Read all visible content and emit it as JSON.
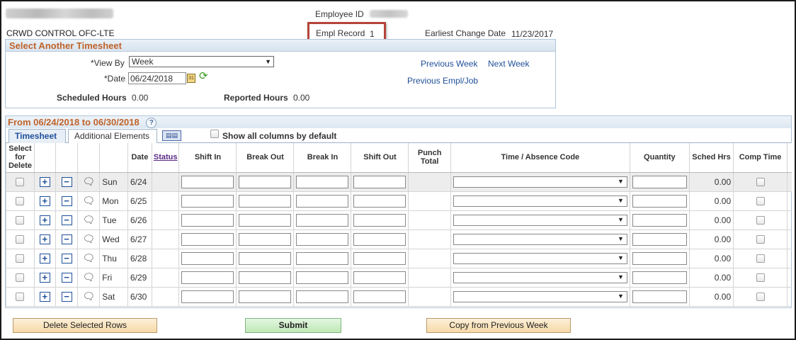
{
  "header": {
    "employee_name": "ALEXTRA GURBSLCHEDX",
    "department": "CRWD CONTROL OFC-LTE",
    "employee_id_label": "Employee ID",
    "employee_id_value": "00712658",
    "empl_record_label": "Empl Record",
    "empl_record_value": "1",
    "earliest_change_label": "Earliest Change Date",
    "earliest_change_value": "11/23/2017"
  },
  "select_panel": {
    "title": "Select Another Timesheet",
    "view_by_label": "*View By",
    "view_by_value": "Week",
    "date_label": "*Date",
    "date_value": "06/24/2018",
    "calendar_icon": "calendar-icon",
    "refresh_icon": "refresh-icon",
    "scheduled_hours_label": "Scheduled Hours",
    "scheduled_hours_value": "0.00",
    "reported_hours_label": "Reported Hours",
    "reported_hours_value": "0.00",
    "previous_week": "Previous Week",
    "next_week": "Next Week",
    "previous_empl_job": "Previous Empl/Job"
  },
  "timesheet": {
    "range_title": "From 06/24/2018 to 06/30/2018",
    "help_label": "?",
    "tabs": [
      {
        "label": "Timesheet",
        "active": true
      },
      {
        "label": "Additional Elements",
        "active": false
      }
    ],
    "show_all_label": "Show all columns by default",
    "columns": {
      "select_delete": "Select for Delete",
      "date": "Date",
      "status": "Status",
      "shift_in": "Shift In",
      "break_out": "Break Out",
      "break_in": "Break In",
      "shift_out": "Shift Out",
      "punch_total": "Punch Total",
      "time_code": "Time / Absence Code",
      "quantity": "Quantity",
      "sched_hrs": "Sched Hrs",
      "comp_time": "Comp Time"
    },
    "rows": [
      {
        "day": "Sun",
        "date": "6/24",
        "sched": "0.00"
      },
      {
        "day": "Mon",
        "date": "6/25",
        "sched": "0.00"
      },
      {
        "day": "Tue",
        "date": "6/26",
        "sched": "0.00"
      },
      {
        "day": "Wed",
        "date": "6/27",
        "sched": "0.00"
      },
      {
        "day": "Thu",
        "date": "6/28",
        "sched": "0.00"
      },
      {
        "day": "Fri",
        "date": "6/29",
        "sched": "0.00"
      },
      {
        "day": "Sat",
        "date": "6/30",
        "sched": "0.00"
      }
    ]
  },
  "buttons": {
    "delete_rows": "Delete Selected Rows",
    "submit": "Submit",
    "copy_prev": "Copy from Previous Week"
  }
}
